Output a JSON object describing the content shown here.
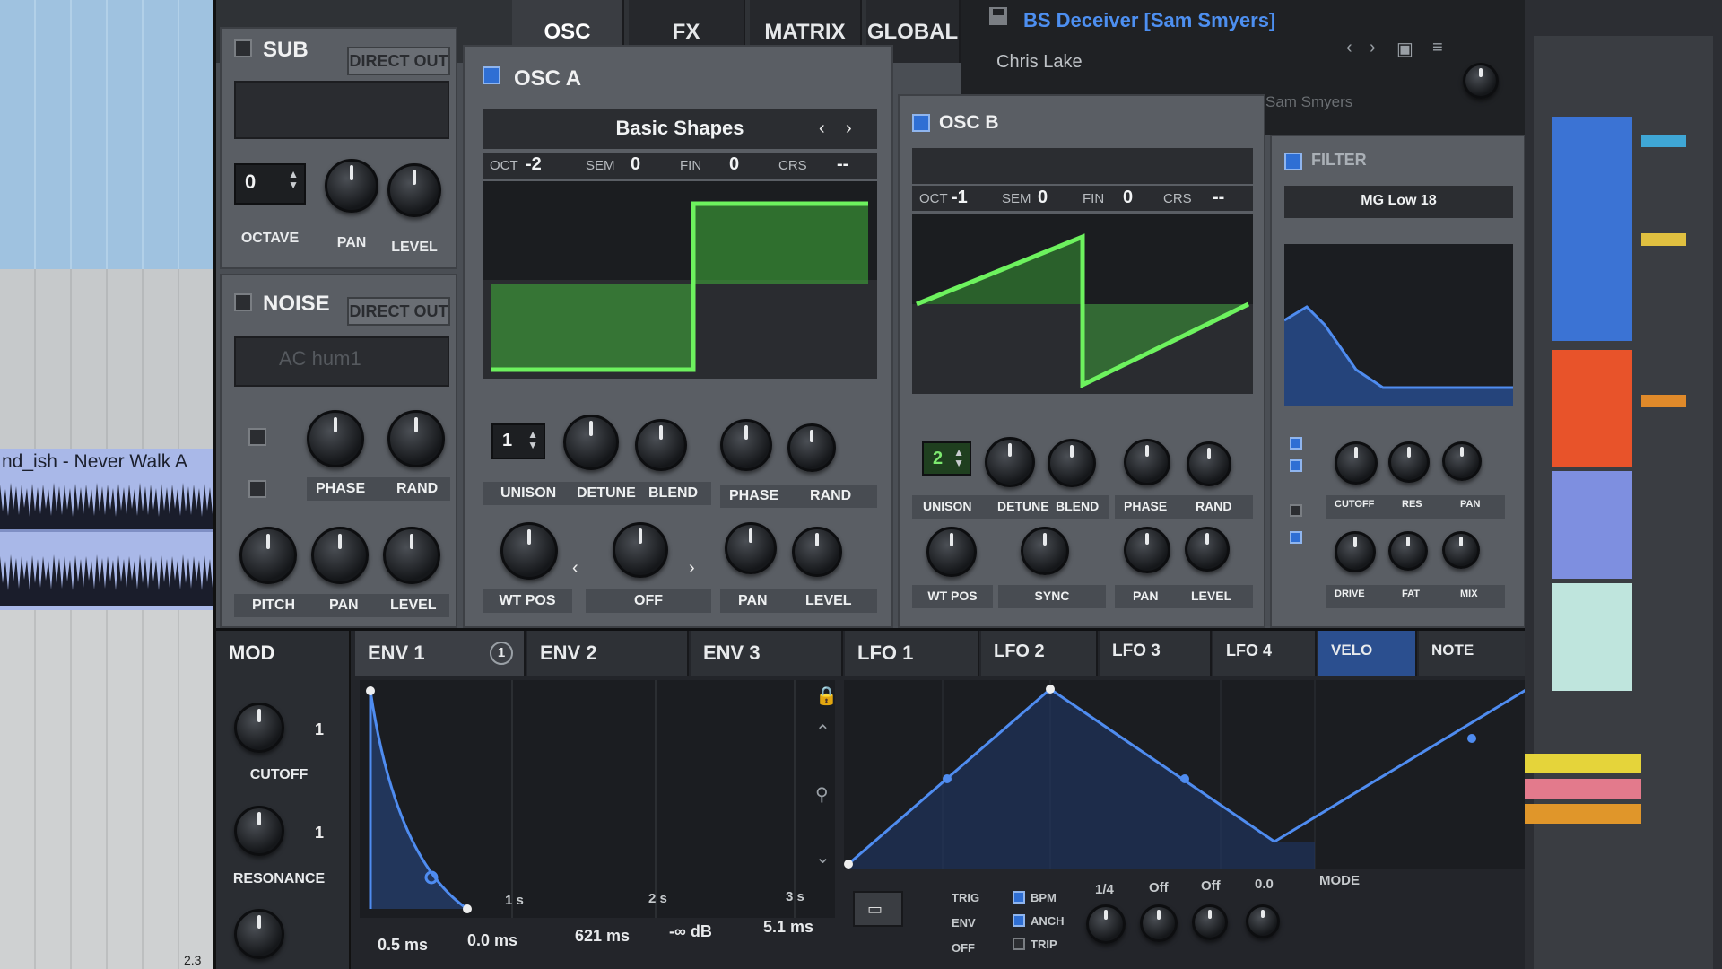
{
  "daw": {
    "clip_title": "nd_ish - Never Walk A",
    "bar_num": "2.3"
  },
  "tabs": [
    {
      "label": "OSC"
    },
    {
      "label": "FX"
    },
    {
      "label": "MATRIX"
    },
    {
      "label": "GLOBAL"
    }
  ],
  "preset": {
    "name": "BS Deceiver [Sam Smyers]",
    "author": "Chris Lake",
    "tag": "Sam Smyers"
  },
  "sub": {
    "title": "SUB",
    "direct_out": "DIRECT OUT",
    "octave_value": "0",
    "labels": {
      "octave": "OCTAVE",
      "pan": "PAN",
      "level": "LEVEL"
    }
  },
  "noise": {
    "title": "NOISE",
    "direct_out": "DIRECT OUT",
    "sample": "AC hum1",
    "labels": {
      "phase": "PHASE",
      "rand": "RAND",
      "pitch": "PITCH",
      "pan": "PAN",
      "level": "LEVEL"
    }
  },
  "osc_a": {
    "title": "OSC A",
    "wavetable": "Basic Shapes",
    "params": {
      "oct_label": "OCT",
      "oct": "-2",
      "sem_label": "SEM",
      "sem": "0",
      "fin_label": "FIN",
      "fin": "0",
      "crs_label": "CRS",
      "crs": "--"
    },
    "unison_value": "1",
    "labels": {
      "unison": "UNISON",
      "detune": "DETUNE",
      "blend": "BLEND",
      "phase": "PHASE",
      "rand": "RAND",
      "wt_pos": "WT POS",
      "off": "OFF",
      "pan": "PAN",
      "level": "LEVEL"
    }
  },
  "osc_b": {
    "title": "OSC B",
    "params": {
      "oct_label": "OCT",
      "oct": "-1",
      "sem_label": "SEM",
      "sem": "0",
      "fin_label": "FIN",
      "fin": "0",
      "crs_label": "CRS",
      "crs": "--"
    },
    "unison_value": "2",
    "labels": {
      "unison": "UNISON",
      "detune": "DETUNE",
      "blend": "BLEND",
      "phase": "PHASE",
      "rand": "RAND",
      "wt_pos": "WT POS",
      "sync": "SYNC",
      "pan": "PAN",
      "level": "LEVEL"
    }
  },
  "filter": {
    "title": "FILTER",
    "type": "MG Low 18",
    "labels": {
      "cutoff": "CUTOFF",
      "res": "RES",
      "pan": "PAN",
      "drive": "DRIVE",
      "fat": "FAT",
      "mix": "MIX"
    }
  },
  "mod": {
    "title": "MOD",
    "cutoff_label": "CUTOFF",
    "resonance_label": "RESONANCE",
    "cutoff_count": "1",
    "resonance_count": "1"
  },
  "mod_tabs": [
    {
      "label": "ENV 1",
      "badge": "1"
    },
    {
      "label": "ENV 2"
    },
    {
      "label": "ENV 3"
    },
    {
      "label": "LFO 1"
    },
    {
      "label": "LFO 2"
    },
    {
      "label": "LFO 3"
    },
    {
      "label": "LFO 4"
    },
    {
      "label": "VELO"
    },
    {
      "label": "NOTE"
    }
  ],
  "env1": {
    "time_marks": [
      "1 s",
      "2 s",
      "3 s"
    ],
    "attack": "0.5 ms",
    "hold": "0.0 ms",
    "decay": "621 ms",
    "sustain": "-∞ dB",
    "release": "5.1 ms"
  },
  "lfo": {
    "options": [
      "TRIG",
      "ENV",
      "OFF",
      "BPM",
      "ANCH",
      "TRIP"
    ],
    "rate": "1/4",
    "off1": "Off",
    "off2": "Off",
    "val": "0.0",
    "mode": "MODE"
  },
  "colors": {
    "accent_blue": "#3d74d9",
    "osc_green": "#3ecf3a",
    "preset_blue": "#4d8ff0"
  }
}
